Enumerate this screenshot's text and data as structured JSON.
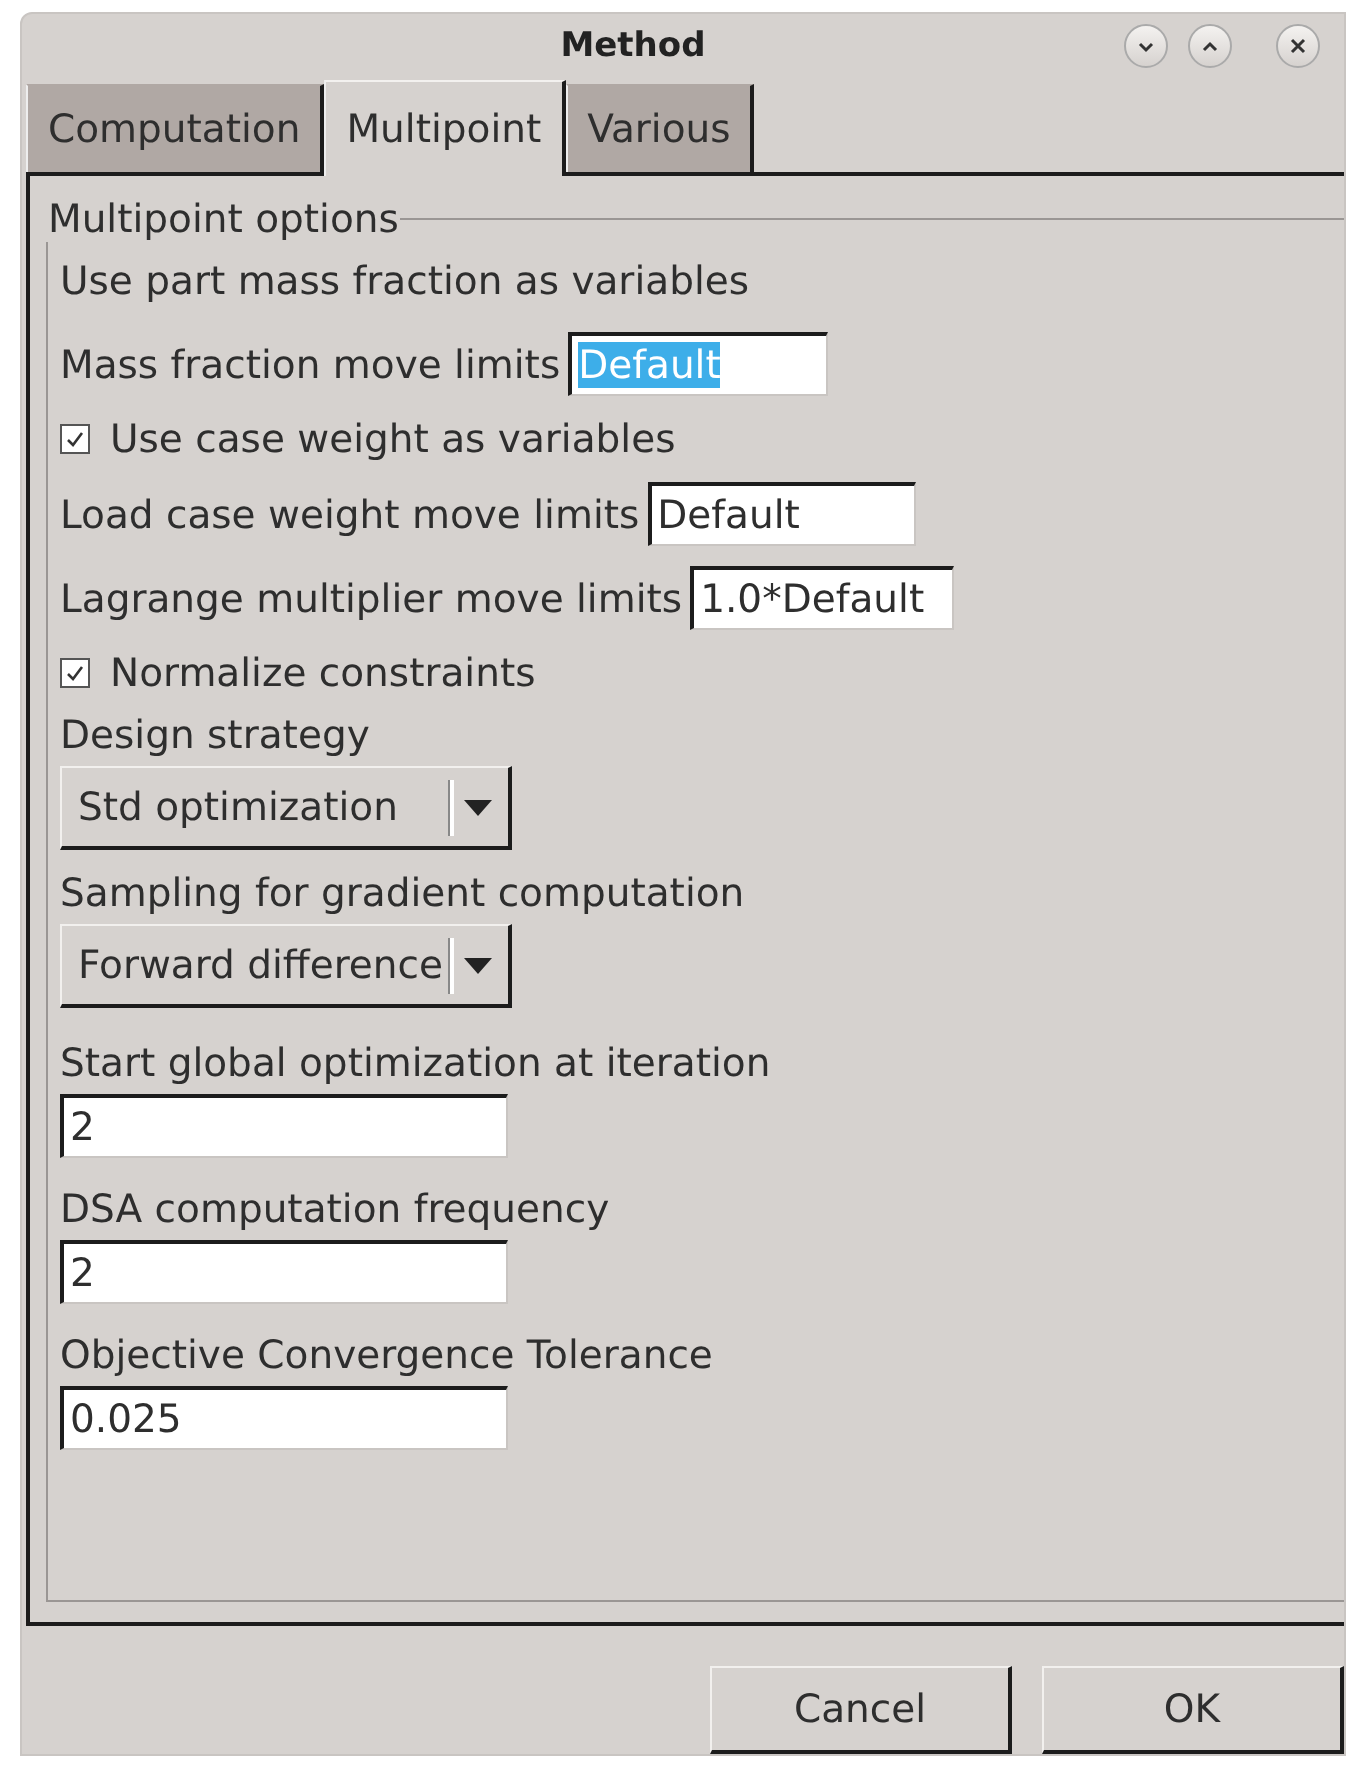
{
  "window": {
    "title": "Method"
  },
  "title_buttons": [
    {
      "kind": "minimize"
    },
    {
      "kind": "maximize"
    },
    {
      "kind": "close"
    }
  ],
  "tabs": [
    {
      "label": "Computation",
      "selected": false
    },
    {
      "label": "Multipoint",
      "selected": true
    },
    {
      "label": "Various",
      "selected": false
    }
  ],
  "group": {
    "title": "Multipoint options",
    "rows": [
      {
        "kind": "label",
        "label": "Use part mass fraction as variables"
      },
      {
        "kind": "inline-field",
        "label": "Mass fraction move limits",
        "value": "Default",
        "highlighted": true
      },
      {
        "kind": "checkbox",
        "label": "Use case weight as variables",
        "checked": true
      },
      {
        "kind": "inline-field",
        "label": "Load case weight move limits",
        "value": "Default",
        "highlighted": false
      },
      {
        "kind": "inline-field",
        "label": "Lagrange multiplier move limits",
        "value": "1.0*Default",
        "highlighted": false
      },
      {
        "kind": "checkbox",
        "label": "Normalize constraints",
        "checked": true
      },
      {
        "kind": "dropdown",
        "label": "Design strategy",
        "value": "Std optimization"
      },
      {
        "kind": "dropdown",
        "label": "Sampling for gradient computation",
        "value": "Forward difference"
      },
      {
        "kind": "stacked-field",
        "label": "Start global optimization at iteration",
        "value": "2"
      },
      {
        "kind": "stacked-field",
        "label": "DSA computation frequency",
        "value": "2"
      },
      {
        "kind": "stacked-field",
        "label": "Objective Convergence Tolerance",
        "value": "0.025"
      }
    ]
  },
  "buttons": [
    "Cancel",
    "OK"
  ]
}
